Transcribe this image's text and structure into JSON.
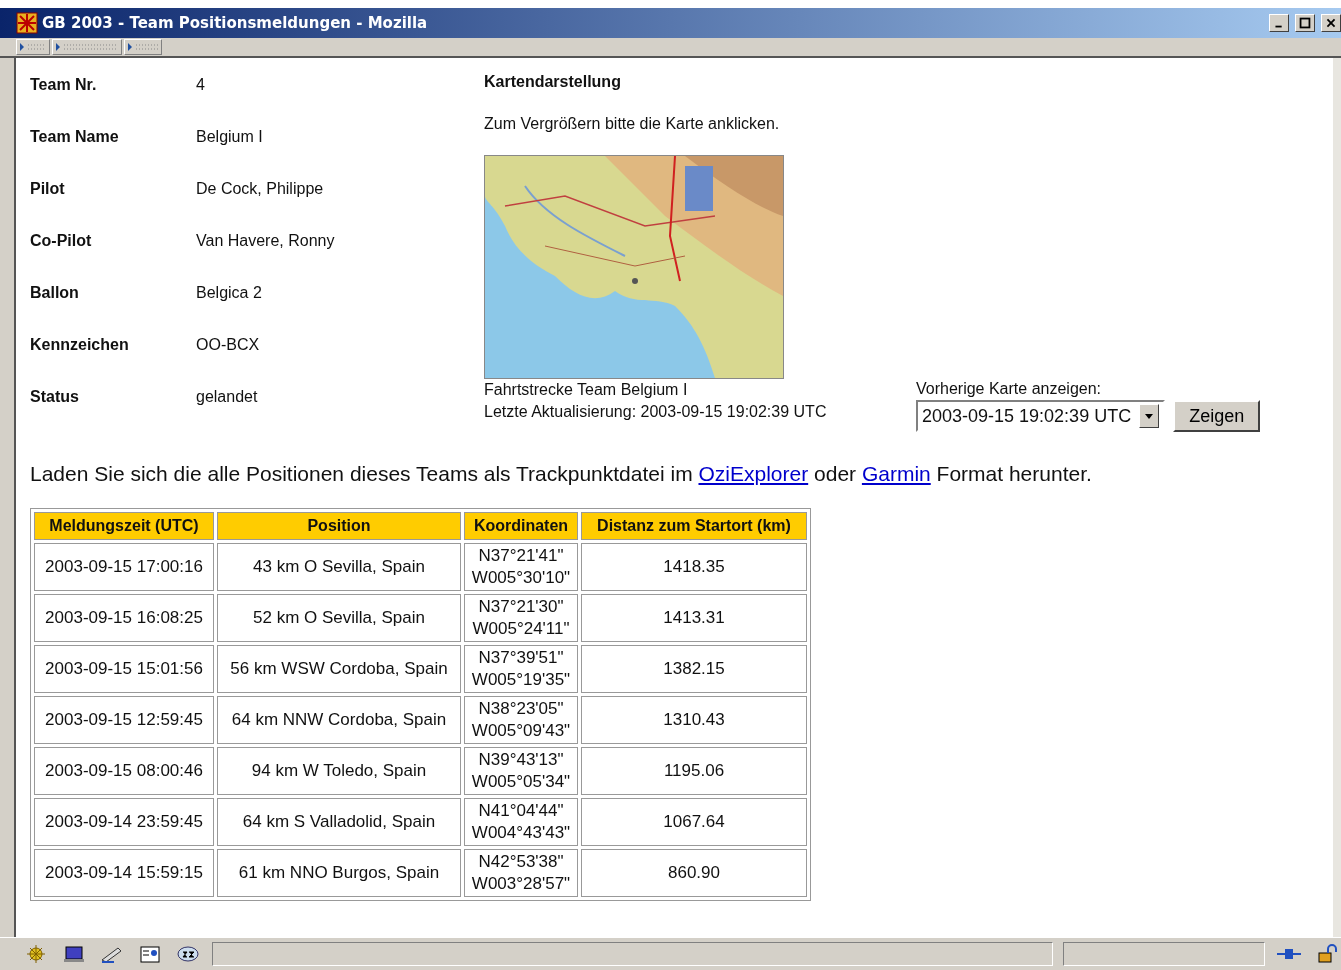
{
  "window": {
    "title": "GB 2003 - Team Positionsmeldungen - Mozilla"
  },
  "team_info": [
    {
      "label": "Team Nr.",
      "value": "4"
    },
    {
      "label": "Team Name",
      "value": "Belgium I"
    },
    {
      "label": "Pilot",
      "value": "De Cock, Philippe"
    },
    {
      "label": "Co-Pilot",
      "value": "Van Havere, Ronny"
    },
    {
      "label": "Ballon",
      "value": "Belgica 2"
    },
    {
      "label": "Kennzeichen",
      "value": "OO-BCX"
    },
    {
      "label": "Status",
      "value": "gelandet"
    }
  ],
  "map_section": {
    "heading": "Kartendarstellung",
    "hint": "Zum Vergrößern bitte die Karte anklicken.",
    "caption": "Fahrtstrecke Team Belgium I",
    "updated": "Letzte Aktualisierung: 2003-09-15 19:02:39 UTC"
  },
  "previous_map": {
    "label": "Vorherige Karte anzeigen:",
    "value": "2003-09-15 19:02:39 UTC",
    "button": "Zeigen"
  },
  "download": [
    {
      "kind": "text",
      "text": "Laden Sie sich die alle Positionen dieses Teams als Trackpunktdatei im "
    },
    {
      "kind": "link",
      "text": "OziExplorer"
    },
    {
      "kind": "text",
      "text": " oder "
    },
    {
      "kind": "link",
      "text": "Garmin"
    },
    {
      "kind": "text",
      "text": " Format herunter."
    }
  ],
  "table": {
    "columns": [
      "Meldungszeit (UTC)",
      "Position",
      "Koordinaten",
      "Distanz zum Startort (km)"
    ],
    "rows": [
      [
        "2003-09-15 17:00:16",
        "43 km O Sevilla, Spain",
        "N37°21'41\"\nW005°30'10\"",
        "1418.35"
      ],
      [
        "2003-09-15 16:08:25",
        "52 km O Sevilla, Spain",
        "N37°21'30\"\nW005°24'11\"",
        "1413.31"
      ],
      [
        "2003-09-15 15:01:56",
        "56 km WSW Cordoba, Spain",
        "N37°39'51\"\nW005°19'35\"",
        "1382.15"
      ],
      [
        "2003-09-15 12:59:45",
        "64 km NNW Cordoba, Spain",
        "N38°23'05\"\nW005°09'43\"",
        "1310.43"
      ],
      [
        "2003-09-15 08:00:46",
        "94 km W Toledo, Spain",
        "N39°43'13\"\nW005°05'34\"",
        "1195.06"
      ],
      [
        "2003-09-14 23:59:45",
        "64 km S Valladolid, Spain",
        "N41°04'44\"\nW004°43'43\"",
        "1067.64"
      ],
      [
        "2003-09-14 15:59:15",
        "61 km NNO Burgos, Spain",
        "N42°53'38\"\nW003°28'57\"",
        "860.90"
      ]
    ]
  }
}
